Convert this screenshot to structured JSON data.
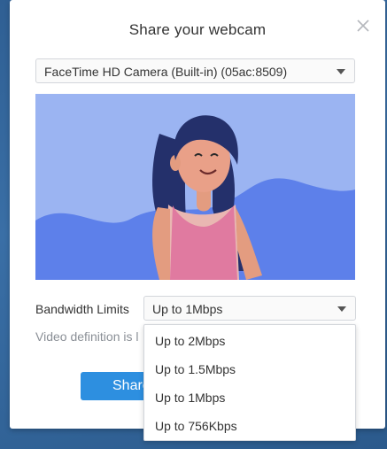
{
  "dialog": {
    "title": "Share your webcam",
    "camera_select": {
      "value": "FaceTime HD Camera (Built-in) (05ac:8509)"
    },
    "bandwidth": {
      "label": "Bandwidth Limits",
      "value": "Up to 1Mbps",
      "options": [
        "Up to 2Mbps",
        "Up to 1.5Mbps",
        "Up to 1Mbps",
        "Up to 756Kbps"
      ]
    },
    "hint": "Video definition is l",
    "share_button": "Share"
  },
  "icons": {
    "close": "close-icon",
    "caret": "chevron-down-icon"
  },
  "colors": {
    "accent": "#2d8fe0",
    "preview_background": "#9bb4f2",
    "preview_wave": "#5d80ea"
  }
}
